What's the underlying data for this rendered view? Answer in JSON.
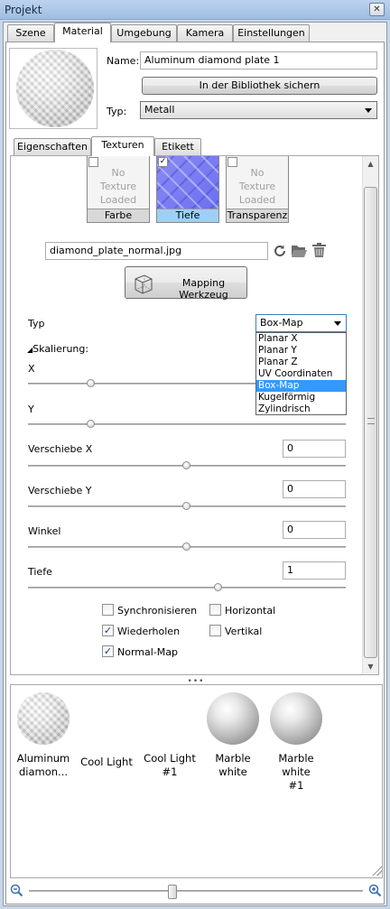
{
  "window": {
    "title": "Projekt",
    "close": "✕"
  },
  "top_tabs": [
    "Szene",
    "Material",
    "Umgebung",
    "Kamera",
    "Einstellungen"
  ],
  "material": {
    "name_label": "Name:",
    "name_value": "Aluminum diamond plate 1",
    "save_button": "In der Bibliothek sichern",
    "type_label": "Typ:",
    "type_value": "Metall"
  },
  "sub_tabs": [
    "Eigenschaften",
    "Texturen",
    "Etikett"
  ],
  "texture_slots": [
    {
      "caption": "Farbe",
      "placeholder": [
        "No",
        "Texture",
        "Loaded"
      ],
      "checked": false
    },
    {
      "caption": "Tiefe",
      "placeholder": [],
      "checked": true
    },
    {
      "caption": "Transparenz",
      "placeholder": [
        "No",
        "Texture",
        "Loaded"
      ],
      "checked": false
    }
  ],
  "texture_file": "diamond_plate_normal.jpg",
  "mapping_button": "Mapping Werkzeug",
  "typ": {
    "label": "Typ",
    "selected": "Box-Map",
    "options": [
      "Planar X",
      "Planar Y",
      "Planar Z",
      "UV Coordinaten",
      "Box-Map",
      "Kugelförmig",
      "Zylindrisch"
    ]
  },
  "skalierung": {
    "label": "Skalierung:",
    "x_label": "X",
    "y_label": "Y",
    "x_level": 0.2,
    "y_level": 0.2
  },
  "fields": [
    {
      "label": "Verschiebe X",
      "value": "0",
      "level": 0.5
    },
    {
      "label": "Verschiebe Y",
      "value": "0",
      "level": 0.5
    },
    {
      "label": "Winkel",
      "value": "0",
      "level": 0.5
    },
    {
      "label": "Tiefe",
      "value": "1",
      "level": 0.6
    }
  ],
  "checkboxes": [
    {
      "label": "Synchronisieren",
      "checked": false
    },
    {
      "label": "Horizontal",
      "checked": false
    },
    {
      "label": "Wiederholen",
      "checked": true
    },
    {
      "label": "Vertikal",
      "checked": false
    },
    {
      "label": "Normal-Map",
      "checked": true
    }
  ],
  "library": [
    {
      "name": "Aluminum diamon...",
      "swatch": "diamond-plate"
    },
    {
      "name": "Cool Light",
      "swatch": "none"
    },
    {
      "name": "Cool Light #1",
      "swatch": "none"
    },
    {
      "name": "Marble white",
      "swatch": "marble"
    },
    {
      "name": "Marble white #1",
      "swatch": "marble"
    }
  ],
  "zoom_level": 0.43,
  "icons": {
    "refresh": "refresh-icon",
    "open": "folder-open-icon",
    "delete": "trash-icon",
    "zoom_out": "zoom-out-icon",
    "zoom_in": "zoom-in-icon"
  }
}
